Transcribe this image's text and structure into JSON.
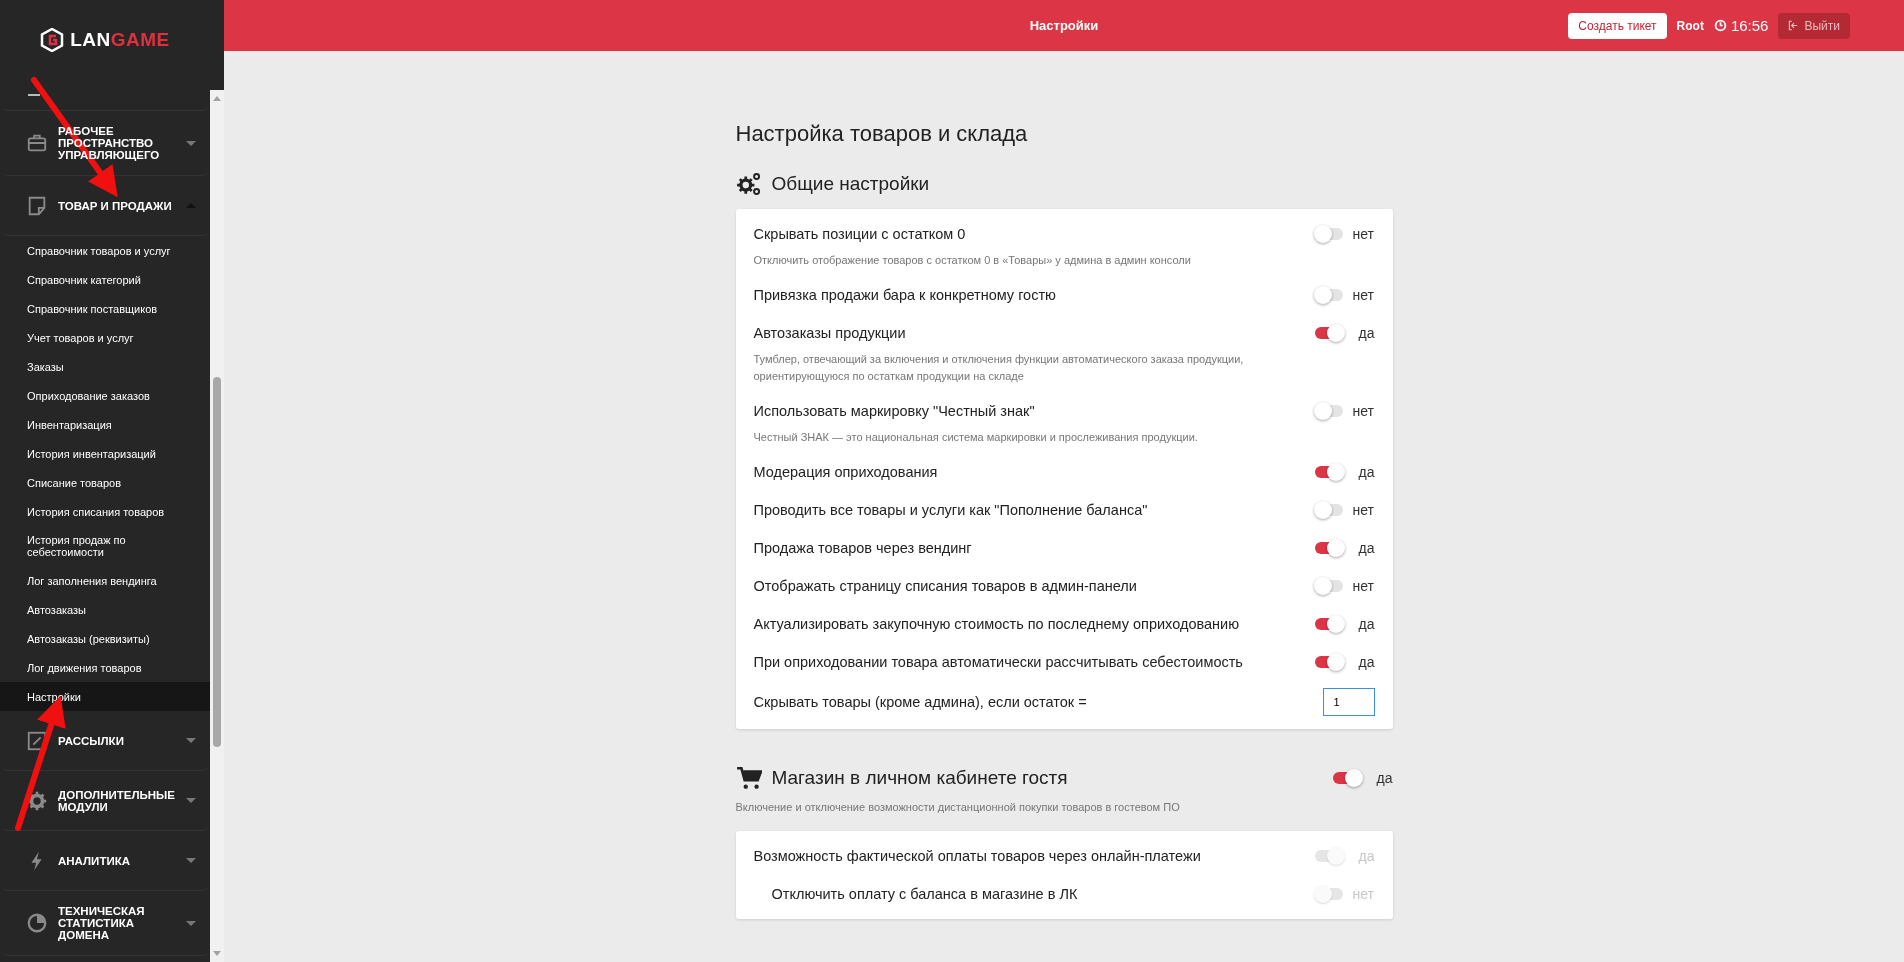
{
  "header": {
    "title": "Настройки",
    "ticket_button": "Создать тикет",
    "user": "Root",
    "time": "16:56",
    "logout_button": "Выйти"
  },
  "sidebar": {
    "logo": {
      "part_1": "LAN",
      "part_2": "GAME"
    },
    "groups": [
      {
        "kind": "briefcase",
        "label": "РАБОЧЕЕ ПРОСТРАНСТВО УПРАВЛЯЮЩЕГО",
        "expanded": false
      },
      {
        "kind": "note",
        "label": "ТОВАР И ПРОДАЖИ",
        "expanded": true,
        "items": [
          {
            "label": "Справочник товаров и услуг",
            "selected": false
          },
          {
            "label": "Справочник категорий",
            "selected": false
          },
          {
            "label": "Справочник поставщиков",
            "selected": false
          },
          {
            "label": "Учет товаров и услуг",
            "selected": false
          },
          {
            "label": "Заказы",
            "selected": false
          },
          {
            "label": "Оприходование заказов",
            "selected": false
          },
          {
            "label": "Инвентаризация",
            "selected": false
          },
          {
            "label": "История инвентаризаций",
            "selected": false
          },
          {
            "label": "Списание товаров",
            "selected": false
          },
          {
            "label": "История списания товаров",
            "selected": false
          },
          {
            "label": "История продаж по себестоимости",
            "selected": false
          },
          {
            "label": "Лог заполнения вендинга",
            "selected": false
          },
          {
            "label": "Автозаказы",
            "selected": false
          },
          {
            "label": "Автозаказы (реквизиты)",
            "selected": false
          },
          {
            "label": "Лог движения товаров",
            "selected": false
          },
          {
            "label": "Настройки",
            "selected": true
          }
        ]
      },
      {
        "kind": "pencil",
        "label": "РАССЫЛКИ",
        "expanded": false
      },
      {
        "kind": "gear",
        "label": "ДОПОЛНИТЕЛЬНЫЕ МОДУЛИ",
        "expanded": false
      },
      {
        "kind": "bolt",
        "label": "АНАЛИТИКА",
        "expanded": false
      },
      {
        "kind": "pie",
        "label": "ТЕХНИЧЕСКАЯ СТАТИСТИКА ДОМЕНА",
        "expanded": false
      }
    ]
  },
  "page": {
    "title": "Настройка товаров и склада",
    "sections": [
      {
        "kind": "gears",
        "title": "Общие настройки",
        "rows": [
          {
            "kind": "toggle",
            "label": "Скрывать позиции с остатком 0",
            "description": "Отключить отображение товаров с остатком 0 в «Товары» у админа в админ консоли",
            "on": false,
            "state_label": "нет"
          },
          {
            "kind": "toggle",
            "label": "Привязка продажи бара к конкретному гостю",
            "on": false,
            "state_label": "нет"
          },
          {
            "kind": "toggle",
            "label": "Автозаказы продукции",
            "description": "Тумблер, отвечающий за включения и отключения функции автоматического заказа продукции, ориентирующуюся по остаткам продукции на складе",
            "on": true,
            "state_label": "да"
          },
          {
            "kind": "toggle",
            "label": "Использовать маркировку \"Честный знак\"",
            "description": "Честный ЗНАК — это национальная система маркировки и прослеживания продукции.",
            "on": false,
            "state_label": "нет"
          },
          {
            "kind": "toggle",
            "label": "Модерация оприходования",
            "on": true,
            "state_label": "да"
          },
          {
            "kind": "toggle",
            "label": "Проводить все товары и услуги как \"Пополнение баланса\"",
            "on": false,
            "state_label": "нет"
          },
          {
            "kind": "toggle",
            "label": "Продажа товаров через вендинг",
            "on": true,
            "state_label": "да"
          },
          {
            "kind": "toggle",
            "label": "Отображать страницу списания товаров в админ-панели",
            "on": false,
            "state_label": "нет"
          },
          {
            "kind": "toggle",
            "label": "Актуализировать закупочную стоимость по последнему оприходованию",
            "on": true,
            "state_label": "да"
          },
          {
            "kind": "toggle",
            "label": "При оприходовании товара автоматически рассчитывать себестоимость",
            "on": true,
            "state_label": "да"
          },
          {
            "kind": "number",
            "label": "Скрывать товары (кроме админа), если остаток =",
            "value": "1"
          }
        ]
      },
      {
        "kind": "cart",
        "title": "Магазин в личном кабинете гостя",
        "toggle": {
          "on": true,
          "state_label": "да"
        },
        "description": "Включение и отключение возможности дистанционной покупки товаров в гостевом ПО",
        "rows": [
          {
            "kind": "toggle",
            "label": "Возможность фактической оплаты товаров через онлайн-платежи",
            "on": true,
            "disabled": true,
            "state_label": "да",
            "children": [
              {
                "kind": "toggle",
                "label": "Отключить оплату с баланса в магазине в ЛК",
                "on": false,
                "disabled": true,
                "state_label": "нет"
              }
            ]
          }
        ]
      }
    ]
  }
}
